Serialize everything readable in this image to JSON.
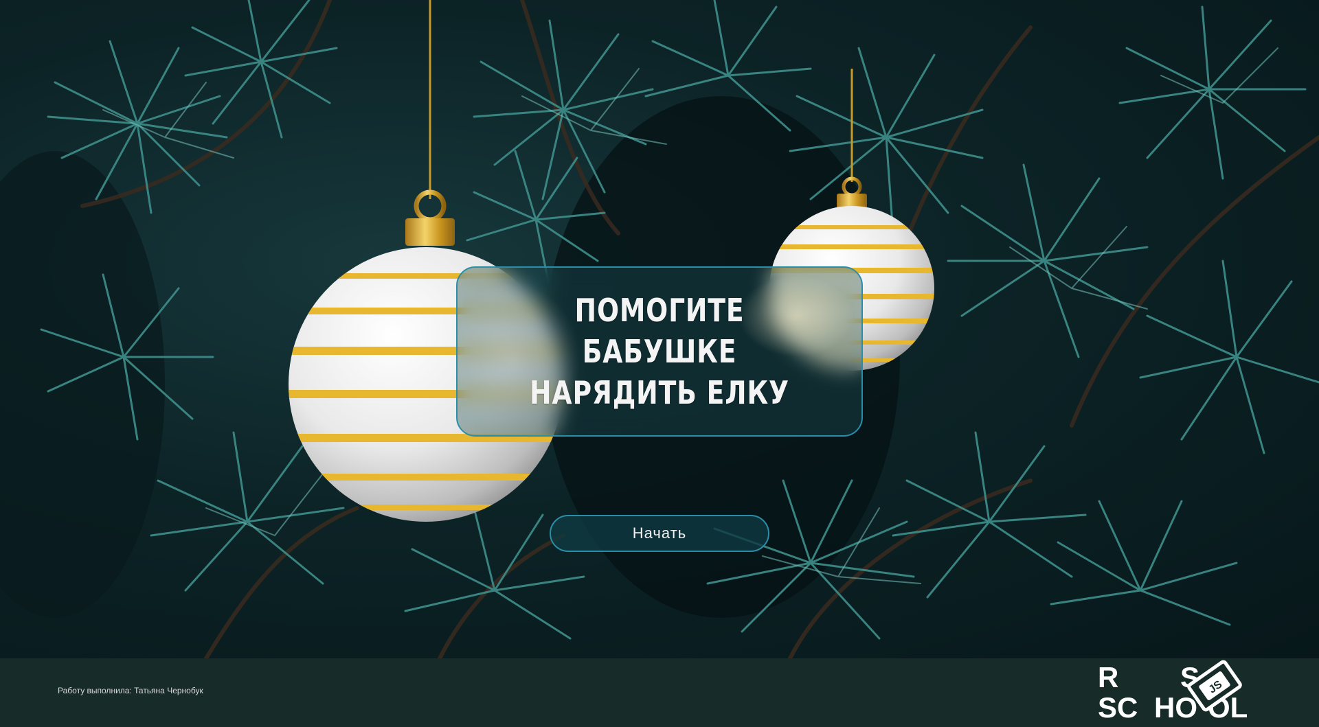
{
  "hero": {
    "title_line_1": "ПОМОГИТЕ БАБУШКЕ",
    "title_line_2": "НАРЯДИТЬ ЕЛКУ"
  },
  "start_button": {
    "label": "Начать"
  },
  "footer": {
    "credit": "Работу выполнила: Татьяна Чернобук",
    "logo": "RS SCHOOL JS"
  },
  "colors": {
    "accent_border": "#2a8ea8",
    "footer_bg": "#172c29",
    "ornament_stripe": "#e7b82f",
    "ornament_body": "#ececec"
  },
  "icons": {
    "ornament_large": "christmas-ornament-icon",
    "ornament_small": "christmas-ornament-icon",
    "logo": "rs-school-logo-icon"
  }
}
